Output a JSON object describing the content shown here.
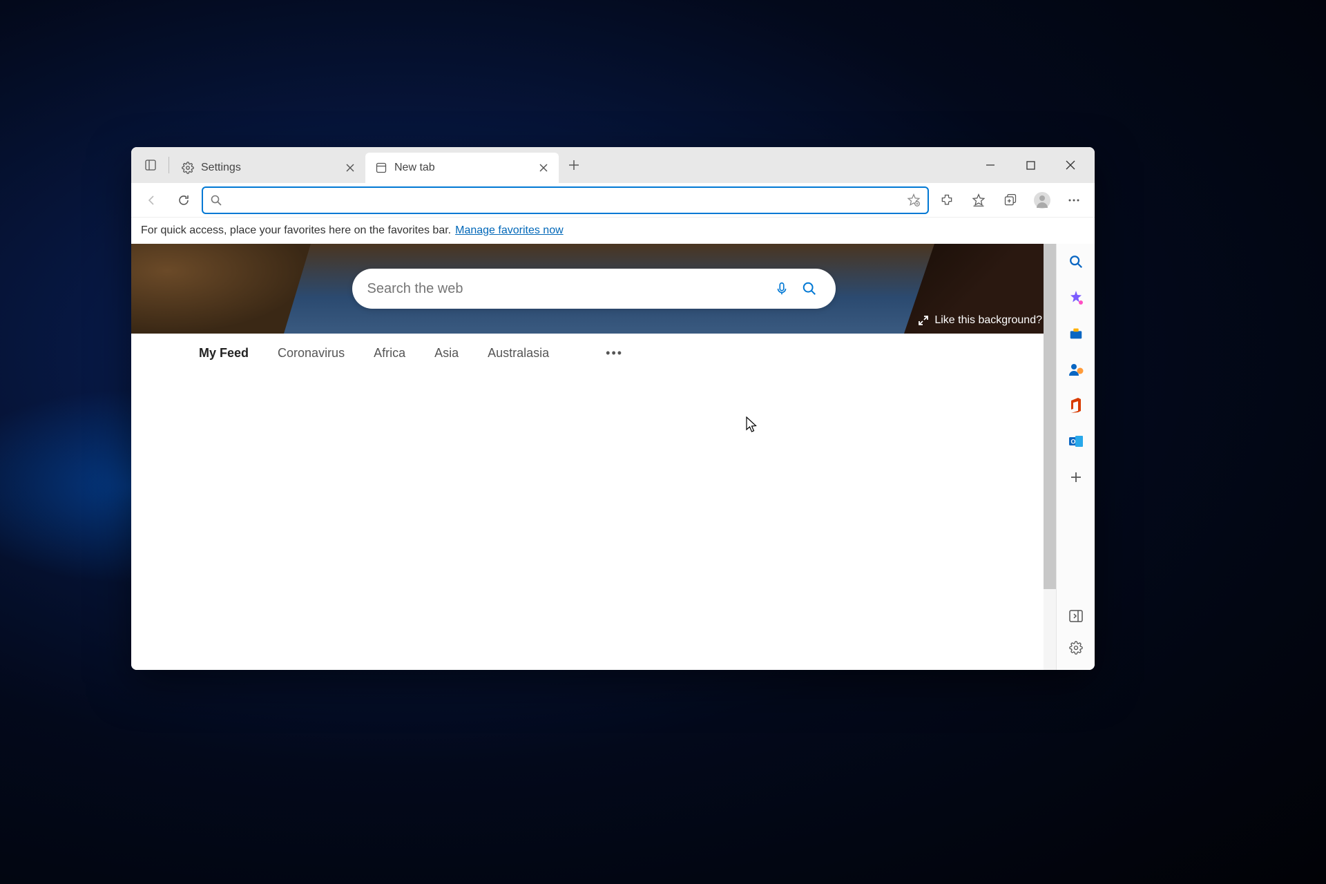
{
  "tabs": [
    {
      "title": "Settings",
      "icon": "gear"
    },
    {
      "title": "New tab",
      "icon": "page",
      "active": true
    }
  ],
  "favbar": {
    "message": "For quick access, place your favorites here on the favorites bar.",
    "link": "Manage favorites now"
  },
  "hero": {
    "search_placeholder": "Search the web",
    "like_bg": "Like this background?"
  },
  "feed": {
    "tabs": [
      "My Feed",
      "Coronavirus",
      "Africa",
      "Asia",
      "Australasia"
    ],
    "active": 0
  }
}
